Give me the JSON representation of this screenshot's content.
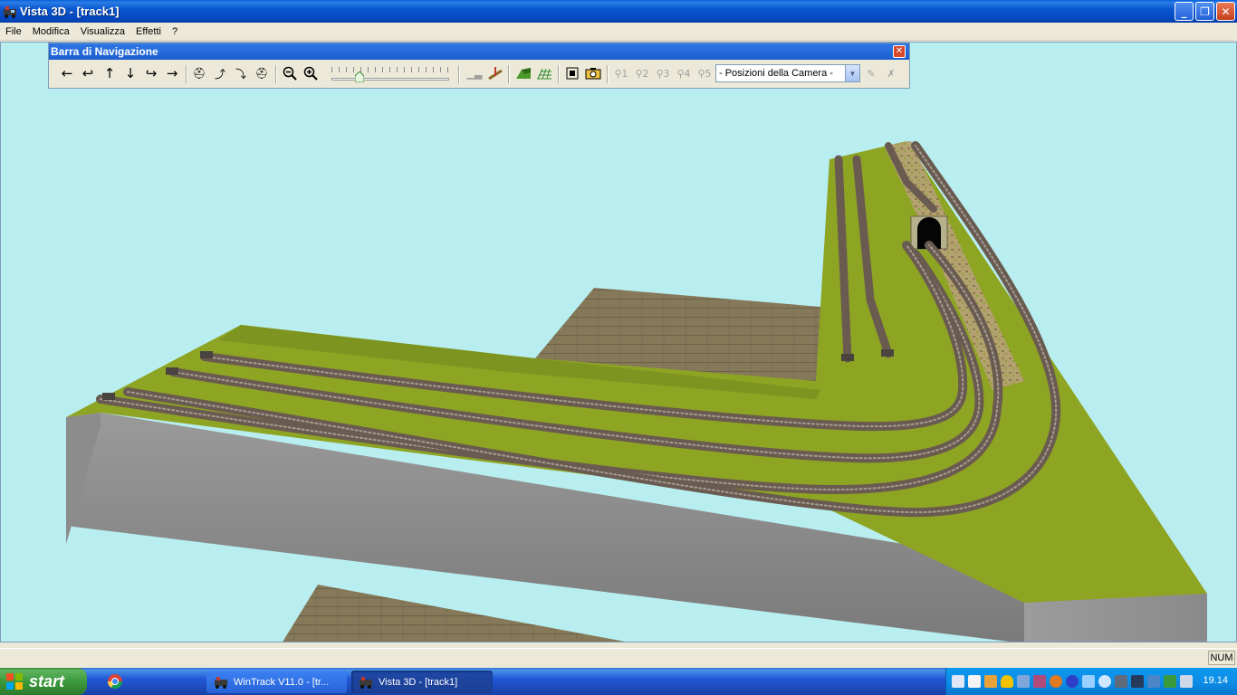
{
  "window": {
    "title": "Vista 3D - [track1]"
  },
  "menu": [
    "File",
    "Modifica",
    "Visualizza",
    "Effetti",
    "?"
  ],
  "navbar": {
    "title": "Barra di Navigazione",
    "camera_select": "- Posizioni della Camera -",
    "zoom_level": 0.22,
    "camera_slots": [
      "1",
      "2",
      "3",
      "4",
      "5"
    ]
  },
  "statusbar": {
    "num": "NUM"
  },
  "taskbar": {
    "start_label": "start",
    "tasks": [
      {
        "label": "WinTrack  V11.0 - [tr..."
      },
      {
        "label": "Vista 3D - [track1]"
      }
    ],
    "clock": "19.14"
  },
  "colors": {
    "sky": "#b9eef0",
    "grass": "#8ea423",
    "wall": "#8e8e8e",
    "floor": "#85795a",
    "rails": "#6a5b50"
  }
}
